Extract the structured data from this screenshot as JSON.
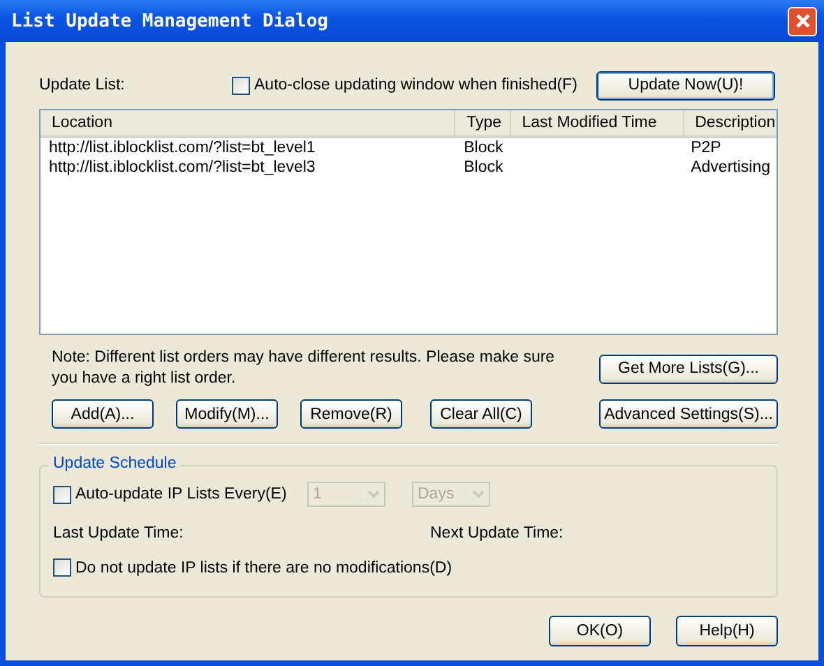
{
  "window": {
    "title": "List Update Management Dialog"
  },
  "update_list_label": "Update List:",
  "auto_close": {
    "label": "Auto-close updating window when finished(F)",
    "checked": false
  },
  "update_now_button": "Update Now(U)!",
  "table": {
    "columns": [
      "Location",
      "Type",
      "Last Modified Time",
      "Description"
    ],
    "rows": [
      {
        "location": "http://list.iblocklist.com/?list=bt_level1",
        "type": "Block",
        "description": "P2P"
      },
      {
        "location": "http://list.iblocklist.com/?list=bt_level3",
        "type": "Block",
        "description": "Advertising"
      }
    ]
  },
  "note": "Note: Different list orders may have different results. Please make sure you have a right list order.",
  "get_more_button": "Get More Lists(G)...",
  "list_buttons": [
    "Add(A)...",
    "Modify(M)...",
    "Remove(R)",
    "Clear All(C)"
  ],
  "advanced_button": "Advanced Settings(S)...",
  "schedule": {
    "title": "Update Schedule",
    "auto_update": {
      "label": "Auto-update IP Lists Every(E)",
      "checked": false
    },
    "interval": {
      "value": "1",
      "disabled": true
    },
    "unit": {
      "value": "Days",
      "disabled": true
    },
    "last_update_label": "Last Update Time:",
    "next_update_label": "Next Update Time:",
    "skip_unmodified": {
      "label": "Do not update IP lists if there are no modifications(D)",
      "checked": false
    }
  },
  "dialog_buttons": [
    "OK(O)",
    "Help(H)"
  ]
}
